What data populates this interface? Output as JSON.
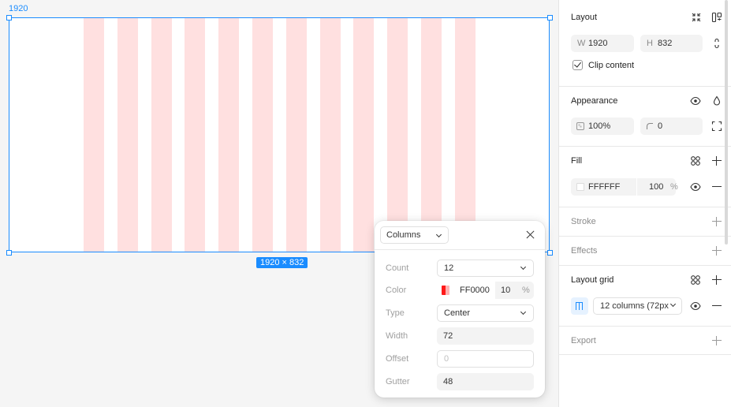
{
  "canvas": {
    "frame_label": "1920",
    "size_badge": "1920 × 832"
  },
  "popover": {
    "type_select": "Columns",
    "count": {
      "label": "Count",
      "value": "12"
    },
    "color": {
      "label": "Color",
      "hex": "FF0000",
      "opacity": "10",
      "unit": "%"
    },
    "type": {
      "label": "Type",
      "value": "Center"
    },
    "width": {
      "label": "Width",
      "value": "72"
    },
    "offset": {
      "label": "Offset",
      "placeholder": "0"
    },
    "gutter": {
      "label": "Gutter",
      "value": "48"
    }
  },
  "panel": {
    "layout": {
      "title": "Layout",
      "w_label": "W",
      "w_value": "1920",
      "h_label": "H",
      "h_value": "832",
      "clip_label": "Clip content",
      "clip_checked": true
    },
    "appearance": {
      "title": "Appearance",
      "opacity": "100%",
      "radius": "0"
    },
    "fill": {
      "title": "Fill",
      "hex": "FFFFFF",
      "opacity": "100",
      "unit": "%"
    },
    "stroke": {
      "title": "Stroke"
    },
    "effects": {
      "title": "Effects"
    },
    "layout_grid": {
      "title": "Layout grid",
      "value": "12 columns (72px"
    },
    "export": {
      "title": "Export"
    }
  },
  "colors": {
    "accent": "#1a8cff",
    "grid_column": "#ffe0e0",
    "grid_color": "#ff0000"
  },
  "icons": [
    "chevron-down-icon",
    "close-icon",
    "eye-icon",
    "plus-icon",
    "minus-icon",
    "drop-icon",
    "columns-grid-icon",
    "styles-icon",
    "resize-icon",
    "constrain-icon",
    "corner-radius-icon",
    "opacity-icon",
    "fullscreen-icon"
  ]
}
